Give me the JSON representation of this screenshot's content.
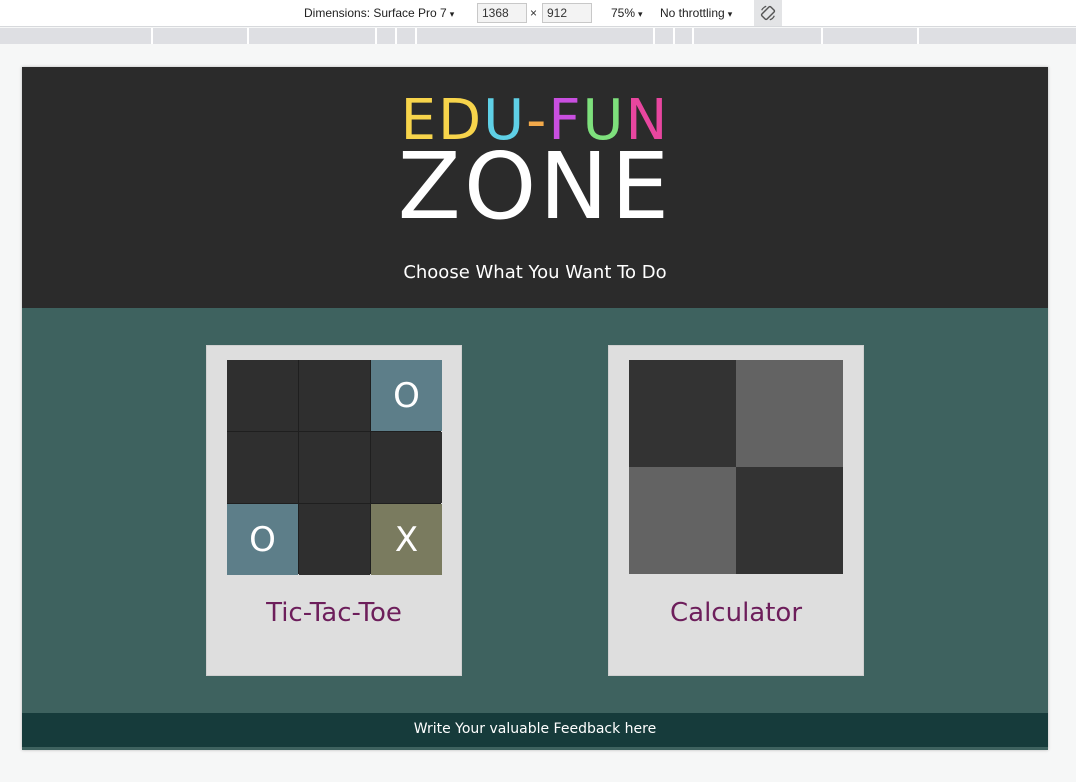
{
  "devtools": {
    "dimensions_label": "Dimensions: Surface Pro 7",
    "width_value": "1368",
    "height_value": "912",
    "times": "×",
    "zoom": "75%",
    "throttling": "No throttling",
    "caret": "▾"
  },
  "header": {
    "logo_letters": [
      {
        "char": "E",
        "color": "#f7d44b"
      },
      {
        "char": "D",
        "color": "#f7d44b"
      },
      {
        "char": "U",
        "color": "#5fd0e6"
      },
      {
        "char": "-",
        "color": "#f2a94a"
      },
      {
        "char": "F",
        "color": "#c94fe0"
      },
      {
        "char": "U",
        "color": "#7ee07c"
      },
      {
        "char": "N",
        "color": "#e8469f"
      }
    ],
    "logo_bottom": "ZONE",
    "subtitle": "Choose What You Want To Do"
  },
  "cards": {
    "tictactoe": {
      "label": "Tic-Tac-Toe",
      "cells": [
        "",
        "",
        "O",
        "",
        "",
        "",
        "O",
        "",
        "X"
      ]
    },
    "calculator": {
      "label": "Calculator"
    }
  },
  "footer": {
    "text": "Write Your valuable Feedback here"
  },
  "colors": {
    "header_bg": "#2b2b2b",
    "main_bg": "#3e625f",
    "footer_bg": "#163b3b",
    "card_label": "#6d1e5b",
    "o_cell": "#5d7e89",
    "x_cell": "#7a7b5f"
  }
}
